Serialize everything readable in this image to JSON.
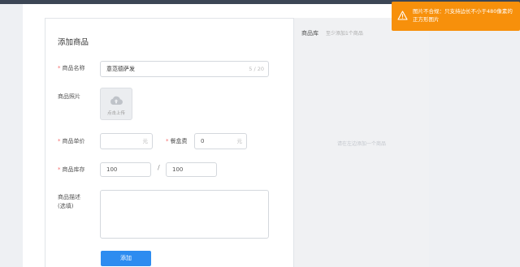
{
  "form": {
    "title": "添加商品",
    "required_mark": "*",
    "name": {
      "label": "商品名称",
      "value": "意范德萨发",
      "counter": "5 / 20"
    },
    "images": {
      "label": "商品照片",
      "upload_text": "点击上传"
    },
    "price": {
      "label": "商品单价",
      "value": "",
      "unit": "元"
    },
    "meal_fee": {
      "label": "餐盒费",
      "value": "0",
      "unit": "元"
    },
    "stock": {
      "label": "商品库存",
      "value": "100",
      "separator": "/",
      "max_value": "100"
    },
    "description": {
      "label_line1": "商品描述",
      "label_line2": "(选填)"
    },
    "submit_label": "添加"
  },
  "library": {
    "title": "商品库",
    "hint": "至少添加1个商品",
    "empty_text": "请在左边添加一个商品"
  },
  "toast": {
    "icon": "warning-icon",
    "message": "图片不合规：只支持边长不小于480像素的正方形图片"
  },
  "colors": {
    "accent": "#2d8cf0",
    "warning": "#f7900b",
    "required": "#f56c6c"
  }
}
